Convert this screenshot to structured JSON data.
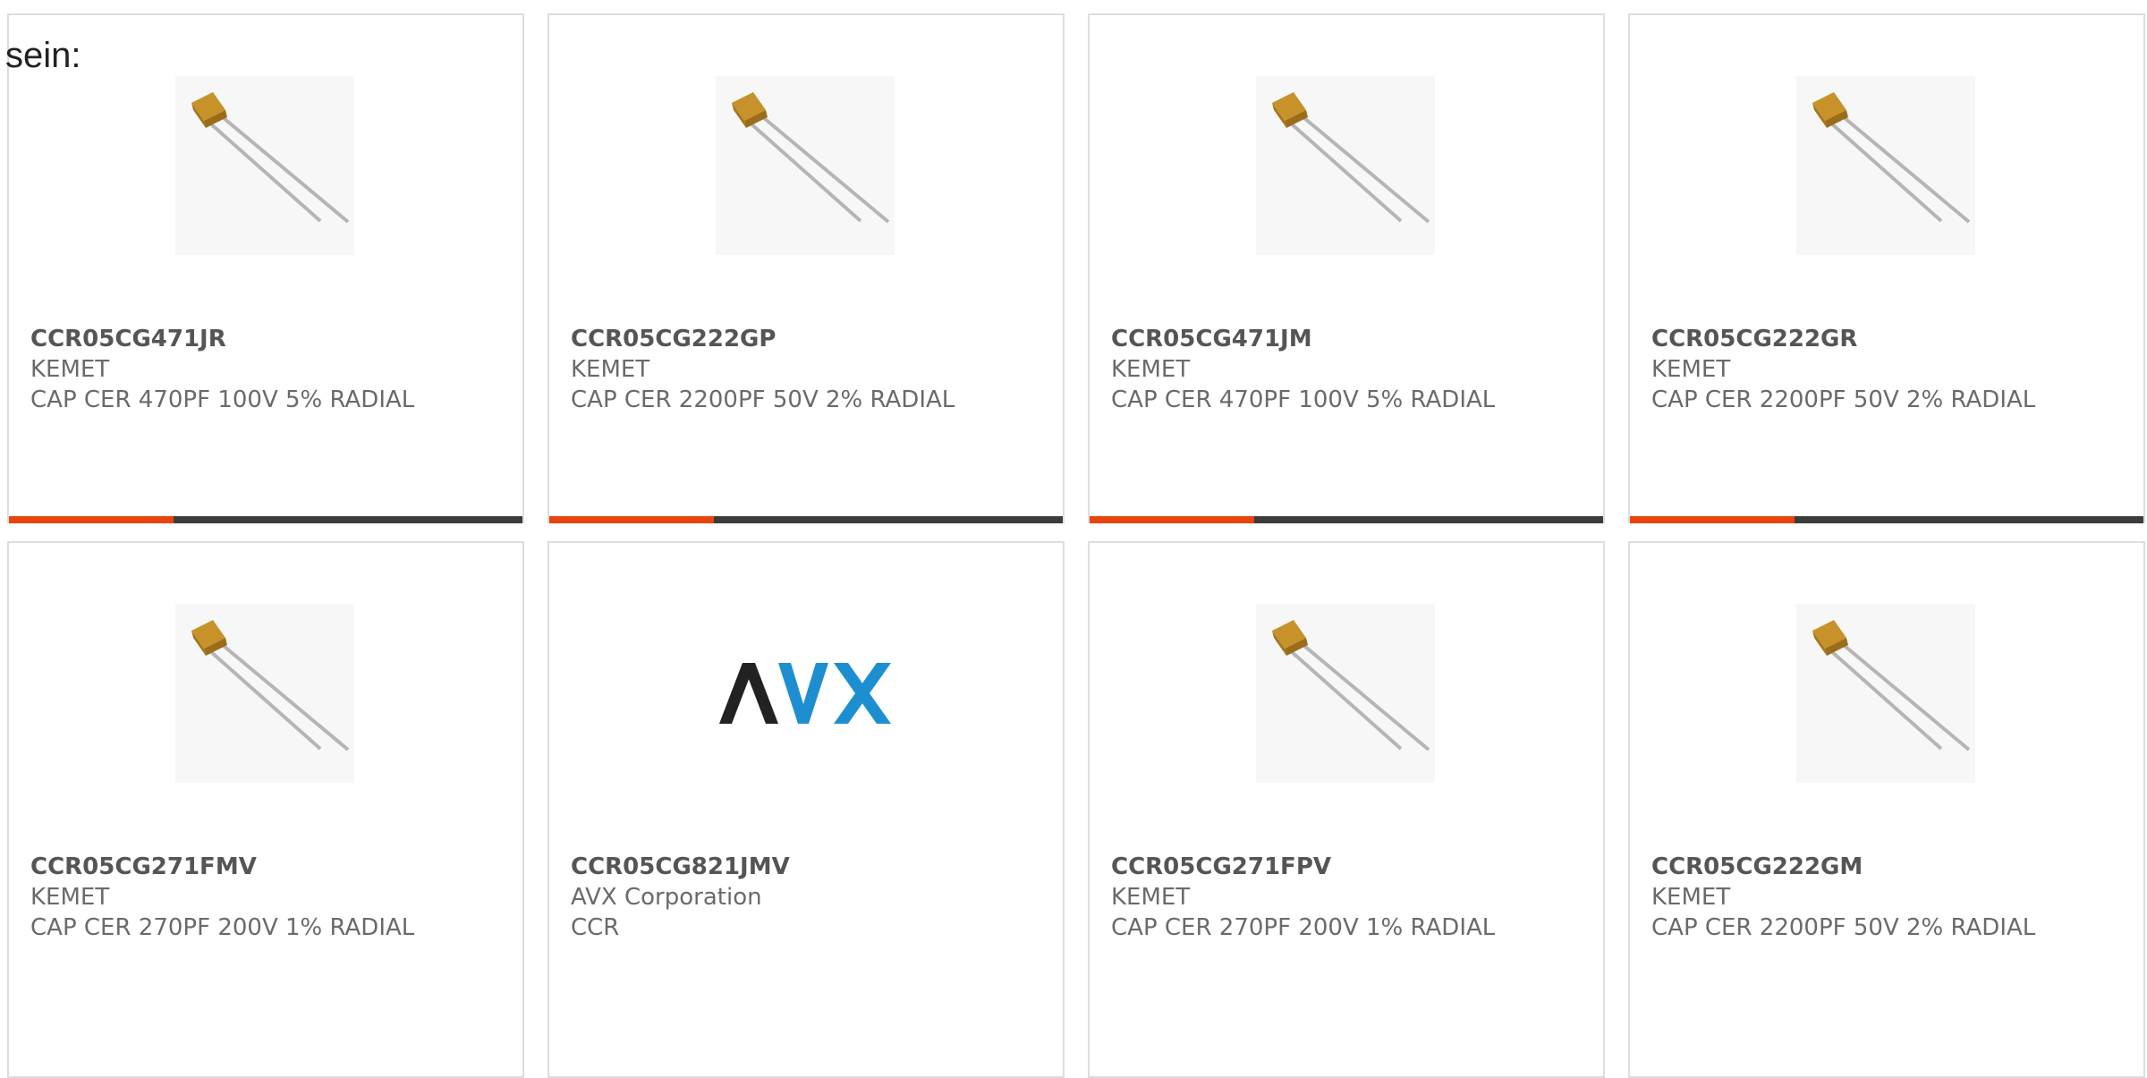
{
  "intro_text": "sein:",
  "colors": {
    "accent": "#e8440e",
    "bar_track": "#3c3c3c",
    "card_border": "#dddddd",
    "text_muted": "#6a6a6a"
  },
  "products": [
    {
      "part": "CCR05CG471JR",
      "maker": "KEMET",
      "desc": "CAP CER 470PF 100V 5% RADIAL",
      "image": "capacitor-icon",
      "progress": 0.32
    },
    {
      "part": "CCR05CG222GP",
      "maker": "KEMET",
      "desc": "CAP CER 2200PF 50V 2% RADIAL",
      "image": "capacitor-icon",
      "progress": 0.32
    },
    {
      "part": "CCR05CG471JM",
      "maker": "KEMET",
      "desc": "CAP CER 470PF 100V 5% RADIAL",
      "image": "capacitor-icon",
      "progress": 0.32
    },
    {
      "part": "CCR05CG222GR",
      "maker": "KEMET",
      "desc": "CAP CER 2200PF 50V 2% RADIAL",
      "image": "capacitor-icon",
      "progress": 0.32
    },
    {
      "part": "CCR05CG271FMV",
      "maker": "KEMET",
      "desc": "CAP CER 270PF 200V 1% RADIAL",
      "image": "capacitor-icon"
    },
    {
      "part": "CCR05CG821JMV",
      "maker": "AVX Corporation",
      "desc": "CCR",
      "image": "avx-logo",
      "logo_text": "AVX"
    },
    {
      "part": "CCR05CG271FPV",
      "maker": "KEMET",
      "desc": "CAP CER 270PF 200V 1% RADIAL",
      "image": "capacitor-icon"
    },
    {
      "part": "CCR05CG222GM",
      "maker": "KEMET",
      "desc": "CAP CER 2200PF 50V 2% RADIAL",
      "image": "capacitor-icon"
    }
  ]
}
